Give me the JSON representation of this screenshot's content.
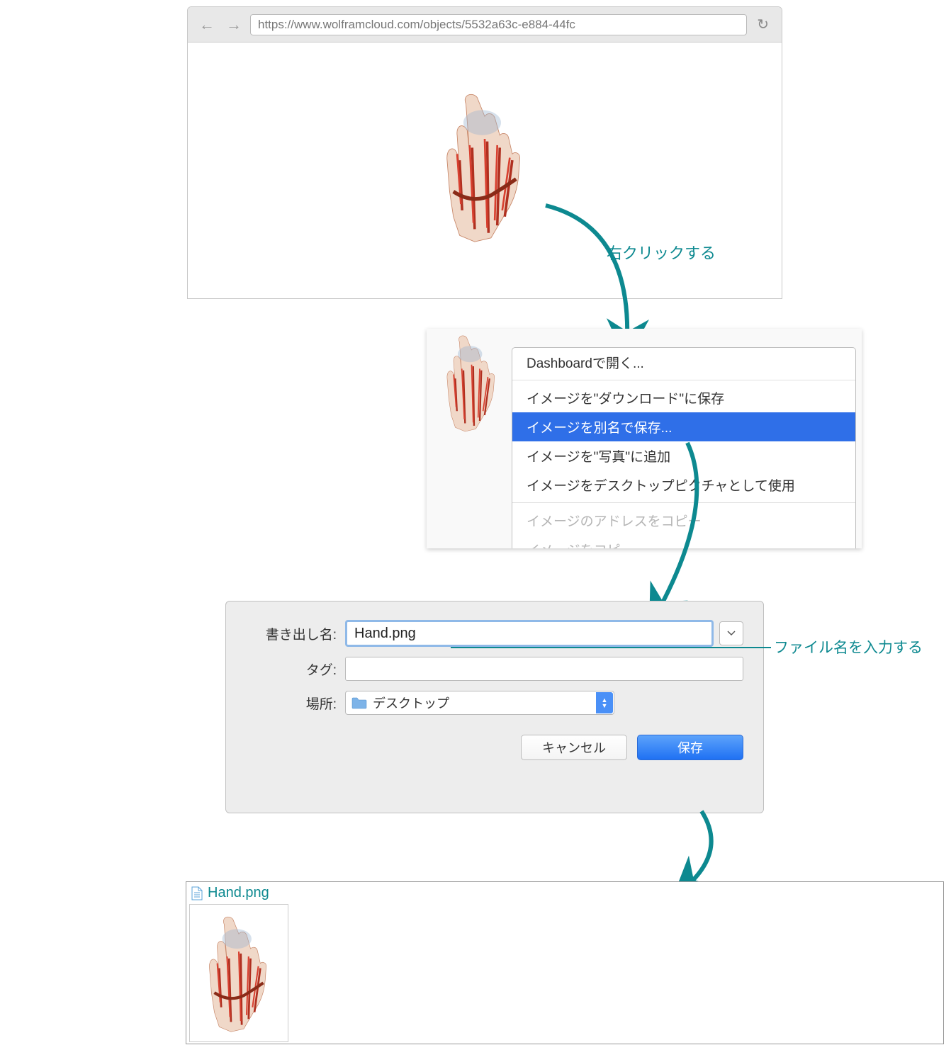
{
  "browser": {
    "url": "https://www.wolframcloud.com/objects/5532a63c-e884-44fc"
  },
  "annotation1": "右クリックする",
  "contextMenu": {
    "dashboard": "Dashboardで開く...",
    "items": [
      "イメージを\"ダウンロード\"に保存",
      "イメージを別名で保存...",
      "イメージを\"写真\"に追加",
      "イメージをデスクトップピクチャとして使用"
    ],
    "disabledItems": [
      "イメージのアドレスをコピー",
      "イメージをコピー"
    ],
    "selectedIndex": 1
  },
  "saveDialog": {
    "filenameLabel": "書き出し名:",
    "filenameValue": "Hand.png",
    "tagsLabel": "タグ:",
    "locationLabel": "場所:",
    "locationValue": "デスクトップ",
    "cancelLabel": "キャンセル",
    "saveLabel": "保存"
  },
  "annotation2": "ファイル名を入力する",
  "resultFile": {
    "name": "Hand.png"
  }
}
